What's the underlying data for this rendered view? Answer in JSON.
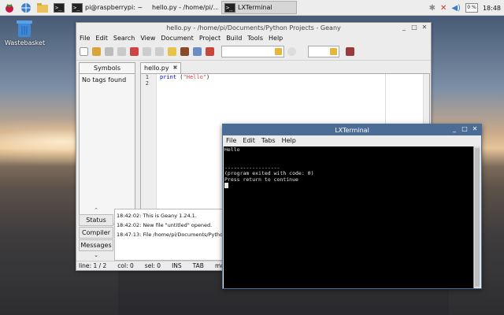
{
  "taskbar": {
    "tasks": [
      {
        "label": "pi@raspberrypi: ~"
      },
      {
        "label": "hello.py - /home/pi/..."
      },
      {
        "label": "LXTerminal"
      }
    ],
    "cpu": "0 %",
    "clock": "18:48"
  },
  "desktop": {
    "trash_label": "Wastebasket"
  },
  "geany": {
    "title": "hello.py - /home/pi/Documents/Python Projects - Geany",
    "menu": [
      "File",
      "Edit",
      "Search",
      "View",
      "Document",
      "Project",
      "Build",
      "Tools",
      "Help"
    ],
    "sidebar_tab": "Symbols",
    "sidebar_text": "No tags found",
    "file_tab": "hello.py",
    "file_tab_close": "✖",
    "line_numbers": [
      "1",
      "2"
    ],
    "code": {
      "keyword": "print",
      "open": " (",
      "string": "\"Hello\"",
      "close": ")"
    },
    "msg_tabs": [
      "Status",
      "Compiler",
      "Messages"
    ],
    "messages": [
      "18:42:02: This is Geany 1.24.1.",
      "18:42:02: New file \"untitled\" opened.",
      "18:47:13: File /home/pi/Documents/Python"
    ],
    "status": {
      "line": "line: 1 / 2",
      "col": "col: 0",
      "sel": "sel: 0",
      "mode1": "INS",
      "mode2": "TAB",
      "mode3": "mode"
    }
  },
  "terminal": {
    "title": "LXTerminal",
    "menu": [
      "File",
      "Edit",
      "Tabs",
      "Help"
    ],
    "lines": [
      "Hello",
      "",
      "",
      "------------------",
      "(program exited with code: 0)",
      "Press return to continue"
    ]
  },
  "colors": {
    "titlebar_active": "#4a6c95",
    "terminal_bg": "#000000"
  }
}
